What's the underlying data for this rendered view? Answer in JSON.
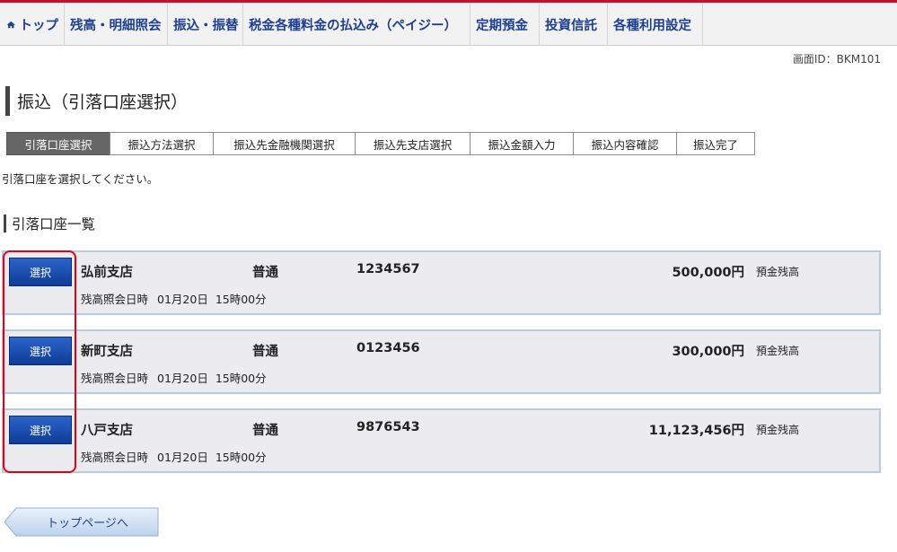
{
  "nav": {
    "items": [
      {
        "label": "トップ"
      },
      {
        "label": "残高・明細照会"
      },
      {
        "label": "振込・振替"
      },
      {
        "label": "税金各種料金の払込み（ペイジー）"
      },
      {
        "label": "定期預金"
      },
      {
        "label": "投資信託"
      },
      {
        "label": "各種利用設定"
      }
    ]
  },
  "screen_id": "画面ID：BKM101",
  "page_title": "振込（引落口座選択）",
  "steps": [
    {
      "label": "引落口座選択",
      "active": true
    },
    {
      "label": "振込方法選択"
    },
    {
      "label": "振込先金融機関選択"
    },
    {
      "label": "振込先支店選択"
    },
    {
      "label": "振込金額入力"
    },
    {
      "label": "振込内容確認"
    },
    {
      "label": "振込完了"
    }
  ],
  "instruction": "引落口座を選択してください。",
  "section_title": "引落口座一覧",
  "accounts": [
    {
      "select_label": "選択",
      "branch": "弘前支店",
      "type": "普通",
      "number": "1234567",
      "amount": "500,000円",
      "amount_label": "預金残高",
      "time_label": "残高照会日時",
      "date": "01月20日",
      "time": "15時00分"
    },
    {
      "select_label": "選択",
      "branch": "新町支店",
      "type": "普通",
      "number": "0123456",
      "amount": "300,000円",
      "amount_label": "預金残高",
      "time_label": "残高照会日時",
      "date": "01月20日",
      "time": "15時00分"
    },
    {
      "select_label": "選択",
      "branch": "八戸支店",
      "type": "普通",
      "number": "9876543",
      "amount": "11,123,456円",
      "amount_label": "預金残高",
      "time_label": "残高照会日時",
      "date": "01月20日",
      "time": "15時00分"
    }
  ],
  "footer": {
    "top_page_label": "トップページへ"
  },
  "colors": {
    "brand_red": "#c8102e",
    "nav_text": "#1f3f8f",
    "highlight": "#e60012",
    "select_button": "#1a4aa8"
  }
}
